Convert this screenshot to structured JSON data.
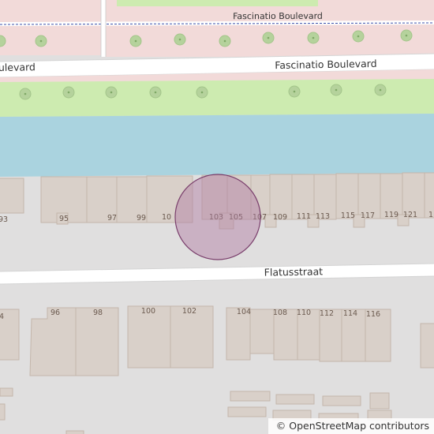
{
  "streets": {
    "fascinatio_top": "Fascinatio Boulevard",
    "fascinatio_left": "ulevard",
    "fascinatio_main": "Fascinatio Boulevard",
    "flatusstraat": "Flatusstraat"
  },
  "house_numbers_north": [
    "93",
    "95",
    "97",
    "99",
    "10",
    "103",
    "105",
    "107",
    "109",
    "111",
    "113",
    "115",
    "117",
    "119",
    "121",
    "1"
  ],
  "house_numbers_south": [
    "4",
    "96",
    "98",
    "100",
    "102",
    "104",
    "108",
    "110",
    "112",
    "114",
    "116"
  ],
  "attribution": {
    "symbol": "©",
    "text": "OpenStreetMap contributors"
  },
  "colors": {
    "background": "#e0dfdf",
    "residential_pink": "#f2dad9",
    "grass": "#cdebb0",
    "water": "#aad3df",
    "road": "#ffffff",
    "building": "#d9d0c9",
    "building_outline": "#c4b6ab",
    "tree": "#b5d29c",
    "boundary_blue": "#3b4fa8",
    "location_marker": "#c9a6bf"
  }
}
